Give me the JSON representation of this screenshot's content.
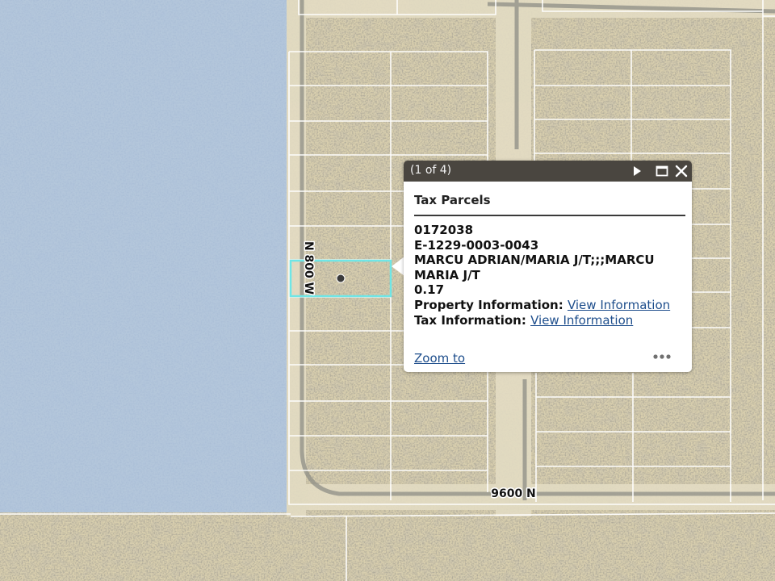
{
  "map": {
    "road_labels": {
      "n800w": "N 800 W",
      "n9600": "9600 N"
    },
    "colors": {
      "terrain": "#d9cfae",
      "overlay": "#a9c4e8",
      "parcel_line": "#ffffff",
      "selection": "#6fe6e6"
    }
  },
  "popup": {
    "count": "(1 of 4)",
    "title": "Tax Parcels",
    "lines": [
      "0172038",
      "E-1229-0003-0043",
      "MARCU ADRIAN/MARIA J/T;;;MARCU MARIA J/T",
      "0.17"
    ],
    "property_label": "Property Information:",
    "property_link": "View Information",
    "tax_label": "Tax Information:",
    "tax_link": "View Information",
    "zoom_to": "Zoom to",
    "icons": [
      "play-icon",
      "maximize-icon",
      "close-icon",
      "more-icon"
    ]
  }
}
